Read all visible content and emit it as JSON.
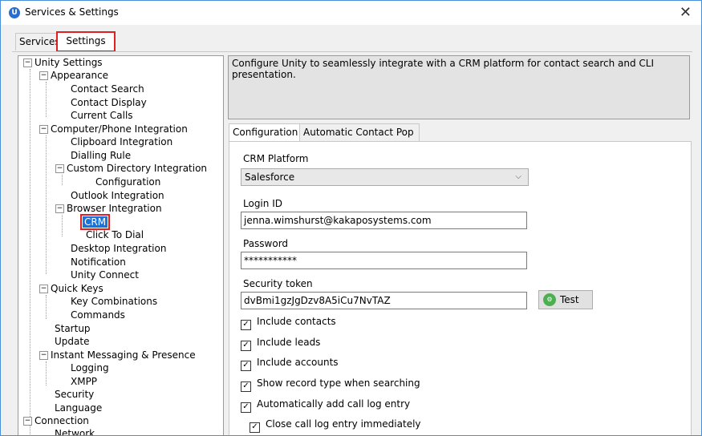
{
  "window": {
    "title": "Services & Settings",
    "app_icon_letter": "U"
  },
  "top_tabs": {
    "services": "Services",
    "settings": "Settings"
  },
  "tree": [
    {
      "label": "Unity Settings"
    },
    {
      "label": "Appearance"
    },
    {
      "label": "Contact Search"
    },
    {
      "label": "Contact Display"
    },
    {
      "label": "Current Calls"
    },
    {
      "label": "Computer/Phone Integration"
    },
    {
      "label": "Clipboard Integration"
    },
    {
      "label": "Dialling Rule"
    },
    {
      "label": "Custom Directory Integration"
    },
    {
      "label": "Configuration"
    },
    {
      "label": "Outlook Integration"
    },
    {
      "label": "Browser Integration"
    },
    {
      "label": "CRM"
    },
    {
      "label": "Click To Dial"
    },
    {
      "label": "Desktop Integration"
    },
    {
      "label": "Notification"
    },
    {
      "label": "Unity Connect"
    },
    {
      "label": "Quick Keys"
    },
    {
      "label": "Key Combinations"
    },
    {
      "label": "Commands"
    },
    {
      "label": "Startup"
    },
    {
      "label": "Update"
    },
    {
      "label": "Instant Messaging & Presence"
    },
    {
      "label": "Logging"
    },
    {
      "label": "XMPP"
    },
    {
      "label": "Security"
    },
    {
      "label": "Language"
    },
    {
      "label": "Connection"
    },
    {
      "label": "Network"
    }
  ],
  "description": "Configure Unity to seamlessly integrate with a CRM platform for contact search and CLI presentation.",
  "inner_tabs": {
    "configuration": "Configuration",
    "auto_pop": "Automatic Contact Pop"
  },
  "form": {
    "crm_platform_label": "CRM Platform",
    "crm_platform_value": "Salesforce",
    "login_label": "Login ID",
    "login_value": "jenna.wimshurst@kakaposystems.com",
    "password_label": "Password",
    "password_value": "***********",
    "token_label": "Security token",
    "token_value": "dvBmi1gzJgDzv8A5iCu7NvTAZ",
    "test_label": "Test",
    "checkboxes": [
      {
        "label": "Include contacts",
        "checked": true
      },
      {
        "label": "Include leads",
        "checked": true
      },
      {
        "label": "Include accounts",
        "checked": true
      },
      {
        "label": "Show record type when searching",
        "checked": true
      },
      {
        "label": "Automatically add call log entry",
        "checked": true
      },
      {
        "label": "Close call log entry immediately",
        "checked": true
      }
    ]
  }
}
